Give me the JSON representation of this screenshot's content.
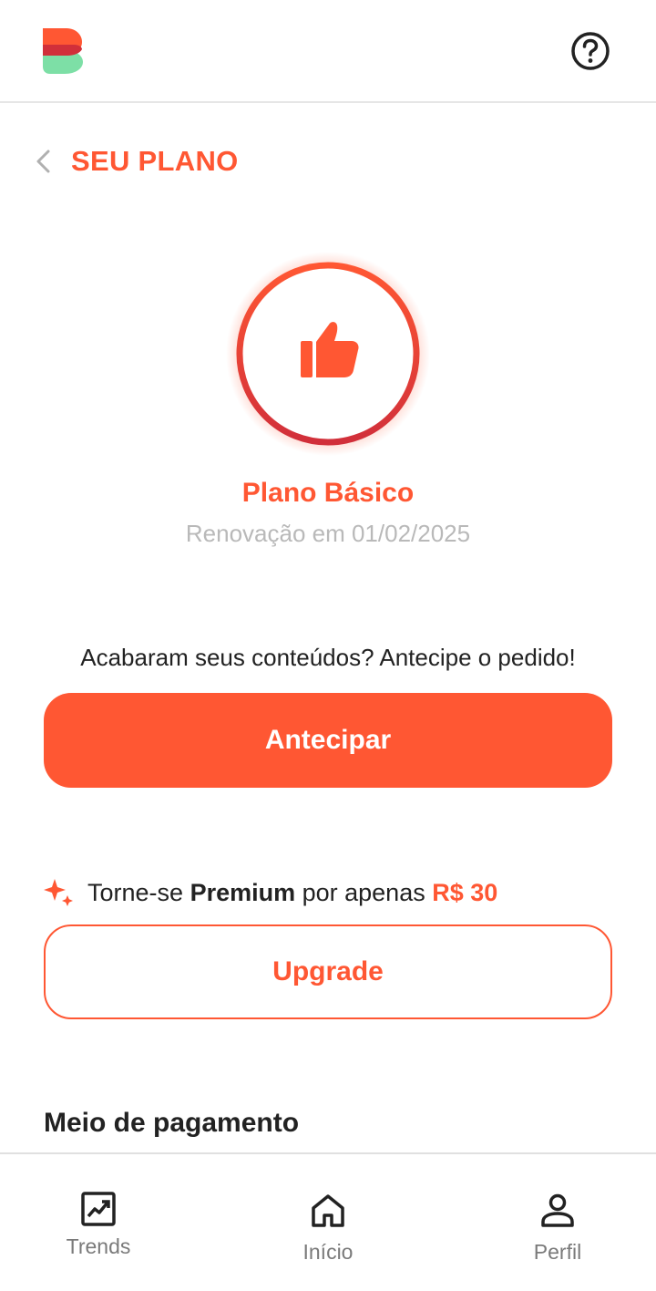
{
  "header": {
    "logo_icon": "brand-logo-icon",
    "help_icon": "question-circle-icon"
  },
  "page": {
    "back_icon": "chevron-left-icon",
    "title": "SEU PLANO"
  },
  "plan": {
    "badge_icon": "thumbs-up-icon",
    "name": "Plano Básico",
    "renewal": "Renovação em 01/02/2025"
  },
  "anticipate": {
    "prompt": "Acabaram seus conteúdos? Antecipe o pedido!",
    "button_label": "Antecipar"
  },
  "premium": {
    "sparkle_icon": "sparkle-icon",
    "text_before": "Torne-se ",
    "highlight": "Premium",
    "text_middle": " por apenas ",
    "price": "R$ 30",
    "button_label": "Upgrade"
  },
  "payment": {
    "title": "Meio de pagamento"
  },
  "nav": {
    "items": [
      {
        "label": "Trends",
        "icon": "trend-chart-icon"
      },
      {
        "label": "Início",
        "icon": "home-icon"
      },
      {
        "label": "Perfil",
        "icon": "user-icon"
      }
    ]
  },
  "colors": {
    "accent": "#ff5733",
    "accent_dark": "#d12f3a",
    "logo_green": "#7ddfa6",
    "muted_text": "#b9b9b9",
    "nav_text": "#7a7a7a"
  }
}
